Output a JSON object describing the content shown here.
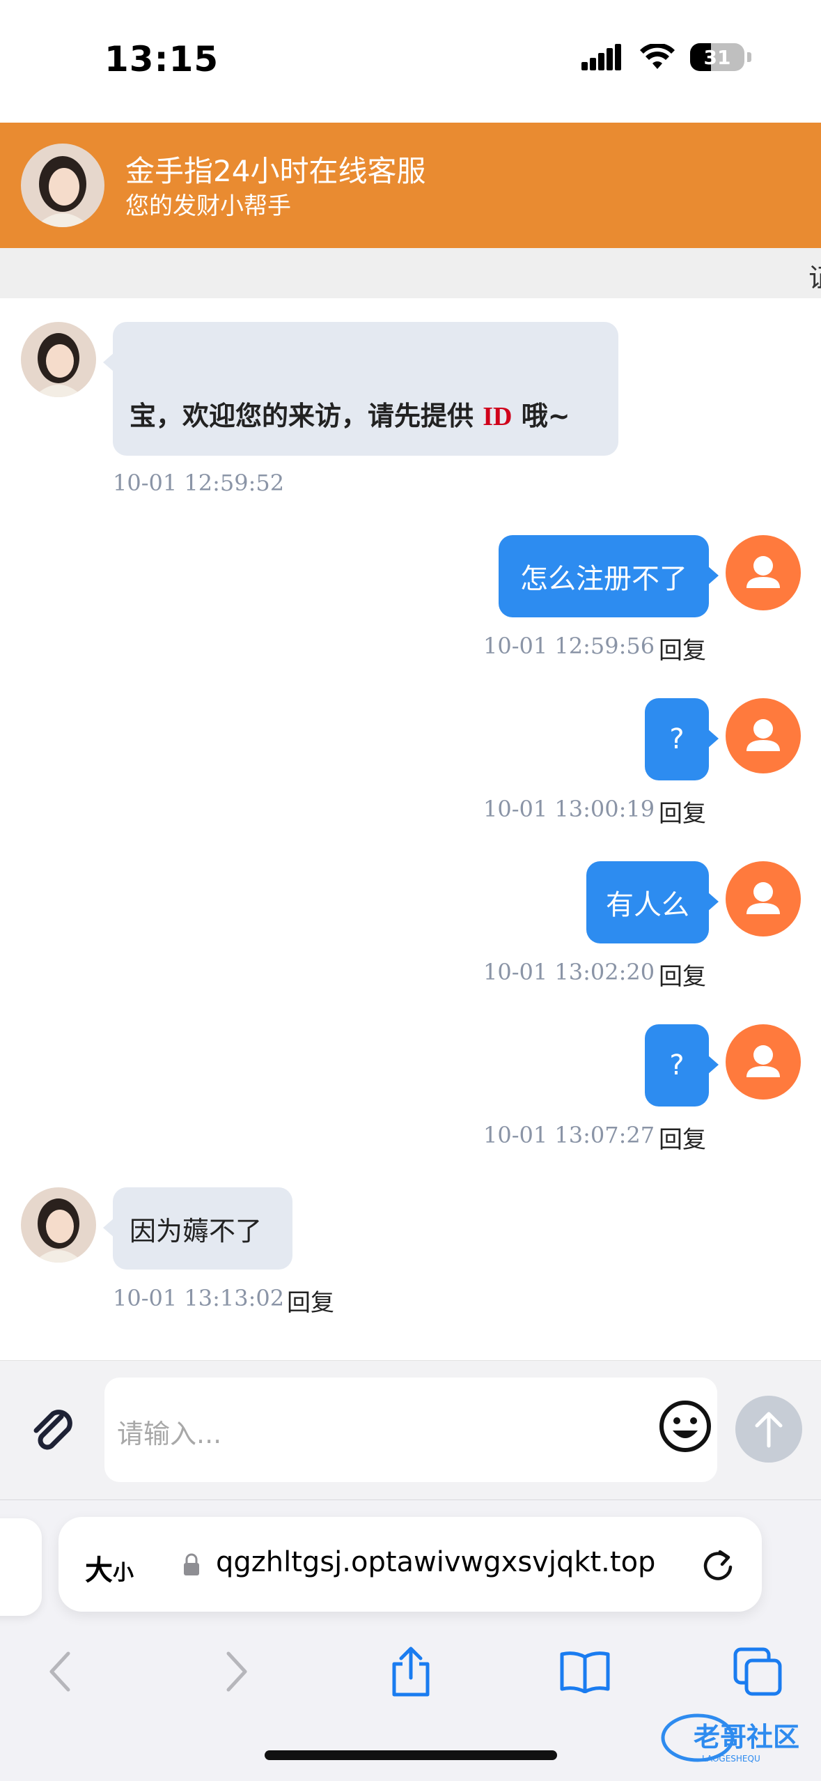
{
  "status_bar": {
    "time": "13:15",
    "battery_level": "31"
  },
  "header": {
    "title": "金手指24小时在线客服",
    "subtitle": "您的发财小帮手",
    "color": "#E98B31"
  },
  "notice": {
    "text": "证"
  },
  "messages": [
    {
      "side": "left",
      "text_before": "宝，欢迎您的来访，请先提供 ",
      "highlight": "ID",
      "text_after": " 哦~",
      "time": "10-01 12:59:52"
    },
    {
      "side": "right",
      "text": "怎么注册不了",
      "time": "10-01 12:59:56",
      "reply": "回复"
    },
    {
      "side": "right",
      "text": "?",
      "time": "10-01 13:00:19",
      "reply": "回复"
    },
    {
      "side": "right",
      "text": "有人么",
      "time": "10-01 13:02:20",
      "reply": "回复"
    },
    {
      "side": "right",
      "text": "?",
      "time": "10-01 13:07:27",
      "reply": "回复"
    },
    {
      "side": "left",
      "text": "因为薅不了",
      "time": "10-01 13:13:02",
      "reply": "回复"
    }
  ],
  "input": {
    "placeholder": "请输入..."
  },
  "browser": {
    "text_size_label_big": "大",
    "text_size_label_small": "小",
    "url": "qgzhltgsj.optawivwgxsvjqkt.top"
  },
  "watermark": {
    "text": "老哥社区",
    "subtext": "LAOGESHEQU"
  },
  "colors": {
    "user_bubble": "#2D8CF0",
    "agent_bubble": "#E4E9F1",
    "user_avatar": "#FF7A3D"
  }
}
